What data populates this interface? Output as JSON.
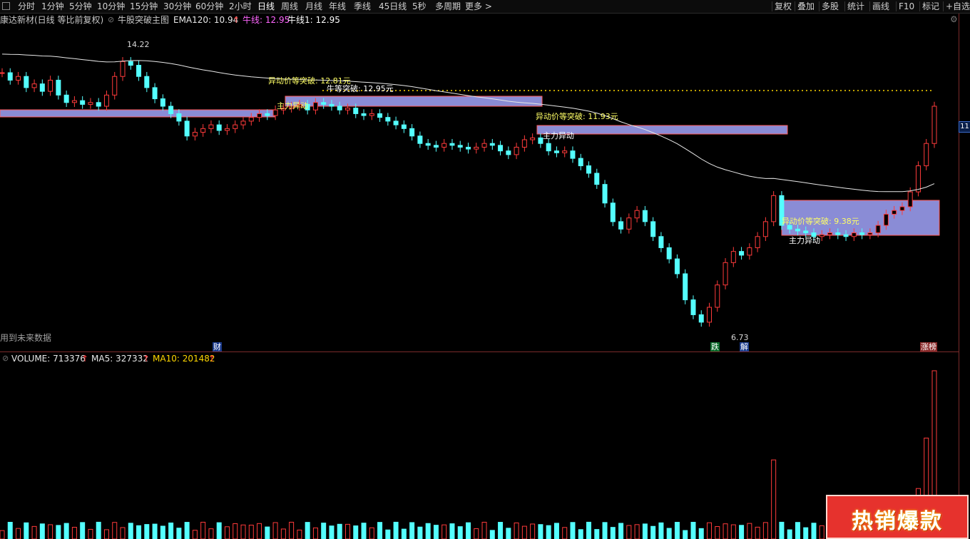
{
  "toolbar": {
    "periods": [
      "分时",
      "1分钟",
      "5分钟",
      "10分钟",
      "15分钟",
      "30分钟",
      "60分钟",
      "2小时",
      "日线",
      "周线",
      "月线",
      "年线",
      "季线",
      "45日线",
      "5秒",
      "多周期",
      "更多 >"
    ],
    "active_period": "日线",
    "right_buttons": [
      "复权",
      "叠加",
      "多股",
      "统计",
      "画线",
      "F10",
      "标记",
      "+自选"
    ]
  },
  "main_info": {
    "stock_title": "康达新材(日线 等比前复权)",
    "indicator_name": "牛股突破主图",
    "ema_label": "EMA120: 10.94",
    "niu_label": "牛线: 12.95",
    "niu1_label": "牛线1: 12.95"
  },
  "volume_info": {
    "volume_label": "VOLUME: 713376",
    "ma5_label": "MA5: 327332",
    "ma10_label": "MA10: 201482"
  },
  "annotations": {
    "high": "14.22",
    "low": "6.73",
    "breakout1": "异动价等突破: 12.81元",
    "breakout2": "牛等突破: 12.95元",
    "breakout3": "异动价等突破: 11.93元",
    "breakout4": "异动价等突破: 9.38元",
    "main_force": "主力异动",
    "future_data": "用到未来数据",
    "axis_tag": "11"
  },
  "flags": {
    "cai": "财",
    "die": "跌",
    "jie": "解",
    "zhangbang": "涨榜"
  },
  "promo": {
    "text": "热销爆款"
  },
  "colors": {
    "up": "#ff3b3b",
    "down": "#54ffff",
    "ema": "#e8e8e8",
    "niu_line": "#ffd700",
    "box": "#8a8cd6",
    "box_border": "#ff5a5a"
  }
}
